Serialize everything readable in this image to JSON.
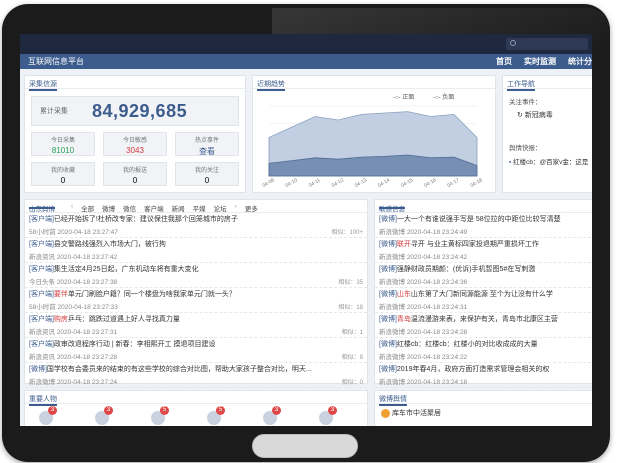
{
  "header": {
    "brand": "互联网信息平台",
    "links": [
      "首页",
      "实时监测",
      "统计分"
    ]
  },
  "stats": {
    "title": "采集信源",
    "total_label": "累计采集",
    "total_value": "84,929,685",
    "cells": [
      {
        "label": "今日采集",
        "value": "81010",
        "color": "#2aa055"
      },
      {
        "label": "今日敏感",
        "value": "3043",
        "color": "#d43b3b"
      },
      {
        "label": "热点事件",
        "value": "查看",
        "color": "#3c5c8e"
      },
      {
        "label": "我的收藏",
        "value": "0",
        "color": "#333333"
      },
      {
        "label": "我的报送",
        "value": "0",
        "color": "#333333"
      },
      {
        "label": "我的关注",
        "value": "0",
        "color": "#333333"
      }
    ]
  },
  "trend": {
    "title": "近期趋势",
    "legend": [
      "正面",
      "负面"
    ],
    "xticks": [
      "04-09",
      "04-10",
      "04-11",
      "04-12",
      "04-13",
      "04-14",
      "04-15",
      "04-16",
      "04-17",
      "04-18"
    ]
  },
  "chart_data": {
    "type": "area",
    "categories": [
      "04-09",
      "04-10",
      "04-11",
      "04-12",
      "04-13",
      "04-14",
      "04-15",
      "04-16",
      "04-17",
      "04-18"
    ],
    "series": [
      {
        "name": "正面",
        "values": [
          55,
          70,
          85,
          80,
          88,
          90,
          92,
          85,
          88,
          55
        ]
      },
      {
        "name": "负面",
        "values": [
          18,
          22,
          26,
          24,
          27,
          28,
          30,
          26,
          27,
          15
        ]
      }
    ],
    "ylim": [
      0,
      100
    ],
    "legend_position": "top-right"
  },
  "work": {
    "title": "工作导航",
    "section1": "关注事件：",
    "item1": "新冠病毒",
    "section2": "舆情快报：",
    "item2": "红楼cb：@百家v金：这是"
  },
  "left_news": {
    "title": "山东舆情",
    "tabs": [
      "全部",
      "微博",
      "微信",
      "客户端",
      "新闻",
      "平媒",
      "论坛",
      "更多"
    ],
    "items": [
      {
        "src": "[客户端]",
        "tag": "",
        "title": "已经开始拆了!杜桥改专家：建议保住我那个回笼城市的房子",
        "meta": "58小时前",
        "time": "2020-04-18 23:27:47",
        "stat": "相似：100+"
      },
      {
        "src": "[客户端]",
        "tag": "",
        "title": "县交警路线强烈入市场大门，被行拘",
        "meta": "新浪资讯",
        "time": "2020-04-18 23:27:42",
        "stat": ""
      },
      {
        "src": "[客户端]",
        "tag": "",
        "title": "集生活定4月25日起，广东机动车将有重大变化",
        "meta": "今日头条",
        "time": "2020-04-18 23:27:38",
        "stat": "相似：35"
      },
      {
        "src": "[客户端]",
        "tag": "要伴",
        "title": "单元门刷脸户籍？同一个楼盘为啥我家单元门就一头？",
        "meta": "58小时前",
        "time": "2020-04-18 23:27:33",
        "stat": "相似：18"
      },
      {
        "src": "[客户端]",
        "tag": "购房",
        "title": "乒乓：跳跌过道遇上好人寻找真力量",
        "meta": "新浪资讯",
        "time": "2020-04-18 23:27:31",
        "stat": "相似：1"
      },
      {
        "src": "[客户端]",
        "tag": "",
        "title": "政审改退程序行动 | 新春：李相熙开工 摸退项目建设",
        "meta": "新浪资讯",
        "time": "2020-04-18 23:27:28",
        "stat": "相似：8"
      },
      {
        "src": "[微博]",
        "tag": "",
        "title": "国学校有会委员来的结束的有这些学校的综合对比图，帮助大家孩子整合对比，明天...",
        "meta": "新浪微博",
        "time": "2020-04-18 23:27:24",
        "stat": "相似：0"
      }
    ]
  },
  "right_news": {
    "title": "敏感信息",
    "items": [
      {
        "src": "[微博]",
        "tag": "",
        "title": "一大一个有谁说强手写是 58位拉的中距位比较写清楚",
        "meta": "新浪微博",
        "time": "2020-04-18 23:24:49"
      },
      {
        "src": "[微博]",
        "tag": "联开",
        "title": "寻开 与业主黄标四家投退期严重损坏工作",
        "meta": "新浪微博",
        "time": "2020-04-18 23:24:42"
      },
      {
        "src": "[微博]",
        "tag": "",
        "title": "强静财政员期颜：(优诉)手机暂图5#在写刺激",
        "meta": "新浪微博",
        "time": "2020-04-18 23:24:36"
      },
      {
        "src": "[微博]",
        "tag": "山东",
        "title": "山东第了大门新同源能源 至个为让没有什么学",
        "meta": "新浪微博",
        "time": "2020-04-18 23:24:31"
      },
      {
        "src": "[微博]",
        "tag": "青岛",
        "title": "温流漫游来表，来保护有关，青岛市北康区主营",
        "meta": "新浪微博",
        "time": "2020-04-18 23:24:28"
      },
      {
        "src": "[微博]",
        "tag": "",
        "title": "红楼cb：红楼cb：红楼小的对比收成成的大量",
        "meta": "新浪微博",
        "time": "2020-04-18 23:24:22"
      },
      {
        "src": "[微博]",
        "tag": "",
        "title": "2019年春4月，政府方面打造需求管理会相关的权",
        "meta": "新浪微博",
        "time": "2020-04-18 23:24:18"
      }
    ]
  },
  "bottom_left": {
    "title": "重要人物",
    "badges": [
      "3",
      "3",
      "5",
      "5",
      "3",
      "3"
    ]
  },
  "bottom_right": {
    "title": "微博舆情",
    "item": "库车市中活聚居"
  }
}
